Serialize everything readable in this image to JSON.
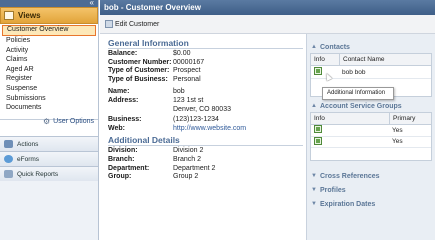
{
  "sidebar": {
    "views_label": "Views",
    "items": [
      {
        "label": "Customer Overview",
        "selected": true
      },
      {
        "label": "Policies"
      },
      {
        "label": "Activity"
      },
      {
        "label": "Claims"
      },
      {
        "label": "Aged AR"
      },
      {
        "label": "Register"
      },
      {
        "label": "Suspense"
      },
      {
        "label": "Submissions"
      },
      {
        "label": "Documents"
      }
    ],
    "user_options_label": "User Options",
    "sections": [
      {
        "label": "Actions",
        "icon": "actions-icon"
      },
      {
        "label": "eForms",
        "icon": "eforms-icon"
      },
      {
        "label": "Quick Reports",
        "icon": "reports-icon"
      }
    ],
    "collapse_glyph": "«"
  },
  "titlebar": {
    "title": "bob - Customer Overview"
  },
  "toolbar": {
    "edit_label": "Edit Customer"
  },
  "general": {
    "title": "General Information",
    "rows1": [
      {
        "k": "Balance:",
        "v": "$0.00"
      },
      {
        "k": "Customer Number:",
        "v": "00000167"
      },
      {
        "k": "Type of Customer:",
        "v": "Prospect"
      },
      {
        "k": "Type of Business:",
        "v": "Personal"
      }
    ],
    "name_k": "Name:",
    "name_v": "bob",
    "address_k": "Address:",
    "address_line1": "123 1st st",
    "address_line2": "Denver, CO 80033",
    "business_k": "Business:",
    "business_v": "(123)123-1234",
    "web_k": "Web:",
    "web_v": "http://www.website.com"
  },
  "additional": {
    "title": "Additional Details",
    "rows": [
      {
        "k": "Division:",
        "v": "Division 2"
      },
      {
        "k": "Branch:",
        "v": "Branch 2"
      },
      {
        "k": "Department:",
        "v": "Department 2"
      },
      {
        "k": "Group:",
        "v": "Group 2"
      }
    ]
  },
  "right": {
    "contacts": {
      "title": "Contacts",
      "col_info": "Info",
      "col_name": "Contact Name",
      "row_name": "bob bob"
    },
    "tooltip": "Additional Information",
    "asg": {
      "title": "Account Service Groups",
      "col_info": "Info",
      "col_primary": "Primary",
      "rows": [
        "Yes",
        "Yes"
      ]
    },
    "collapsed": [
      "Cross References",
      "Profiles",
      "Expiration Dates"
    ],
    "expanded_glyph": "▲",
    "collapsed_glyph": "▼"
  },
  "colors": {
    "accent": "#e8762d",
    "header": "#4d6c94",
    "section_title": "#4b6b95"
  }
}
